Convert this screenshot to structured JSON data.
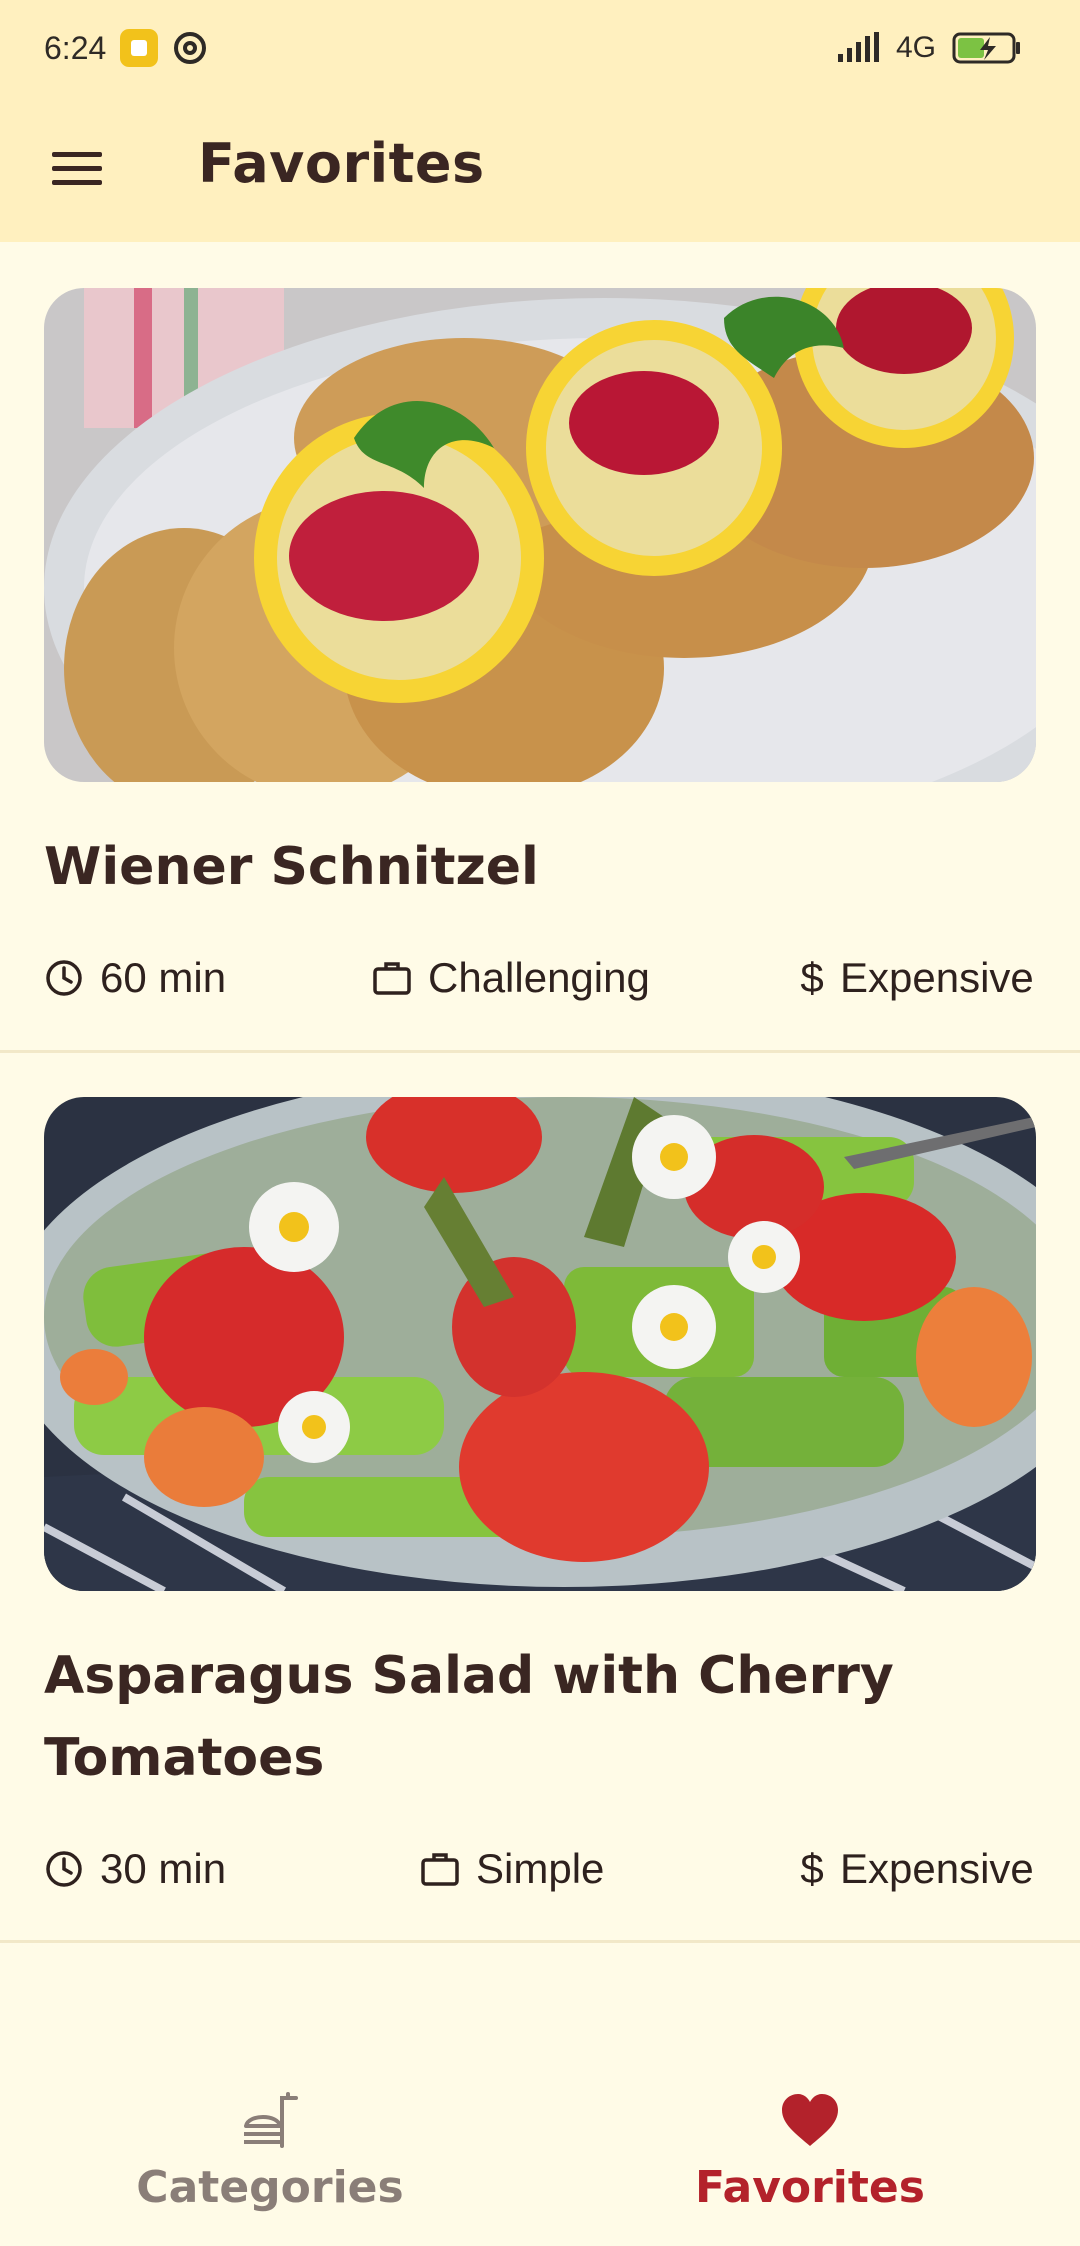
{
  "status_bar": {
    "time": "6:24",
    "network": "4G"
  },
  "app_bar": {
    "title": "Favorites",
    "menu_icon": "menu-icon"
  },
  "meals": [
    {
      "title": "Wiener Schnitzel",
      "duration": "60 min",
      "complexity": "Challenging",
      "affordability": "Expensive",
      "image": "schnitzel-photo"
    },
    {
      "title": "Asparagus Salad with Cherry Tomatoes",
      "duration": "30 min",
      "complexity": "Simple",
      "affordability": "Expensive",
      "image": "asparagus-salad-photo"
    }
  ],
  "bottom_nav": {
    "items": [
      {
        "label": "Categories",
        "icon": "restaurant-menu-icon",
        "selected": false
      },
      {
        "label": "Favorites",
        "icon": "heart-icon",
        "selected": true
      }
    ]
  },
  "colors": {
    "bar_background": "#FFF0BF",
    "page_background": "#FFFBE7",
    "text_primary": "#3A2622",
    "nav_selected": "#B3222B",
    "nav_unselected": "#8A7E78"
  }
}
